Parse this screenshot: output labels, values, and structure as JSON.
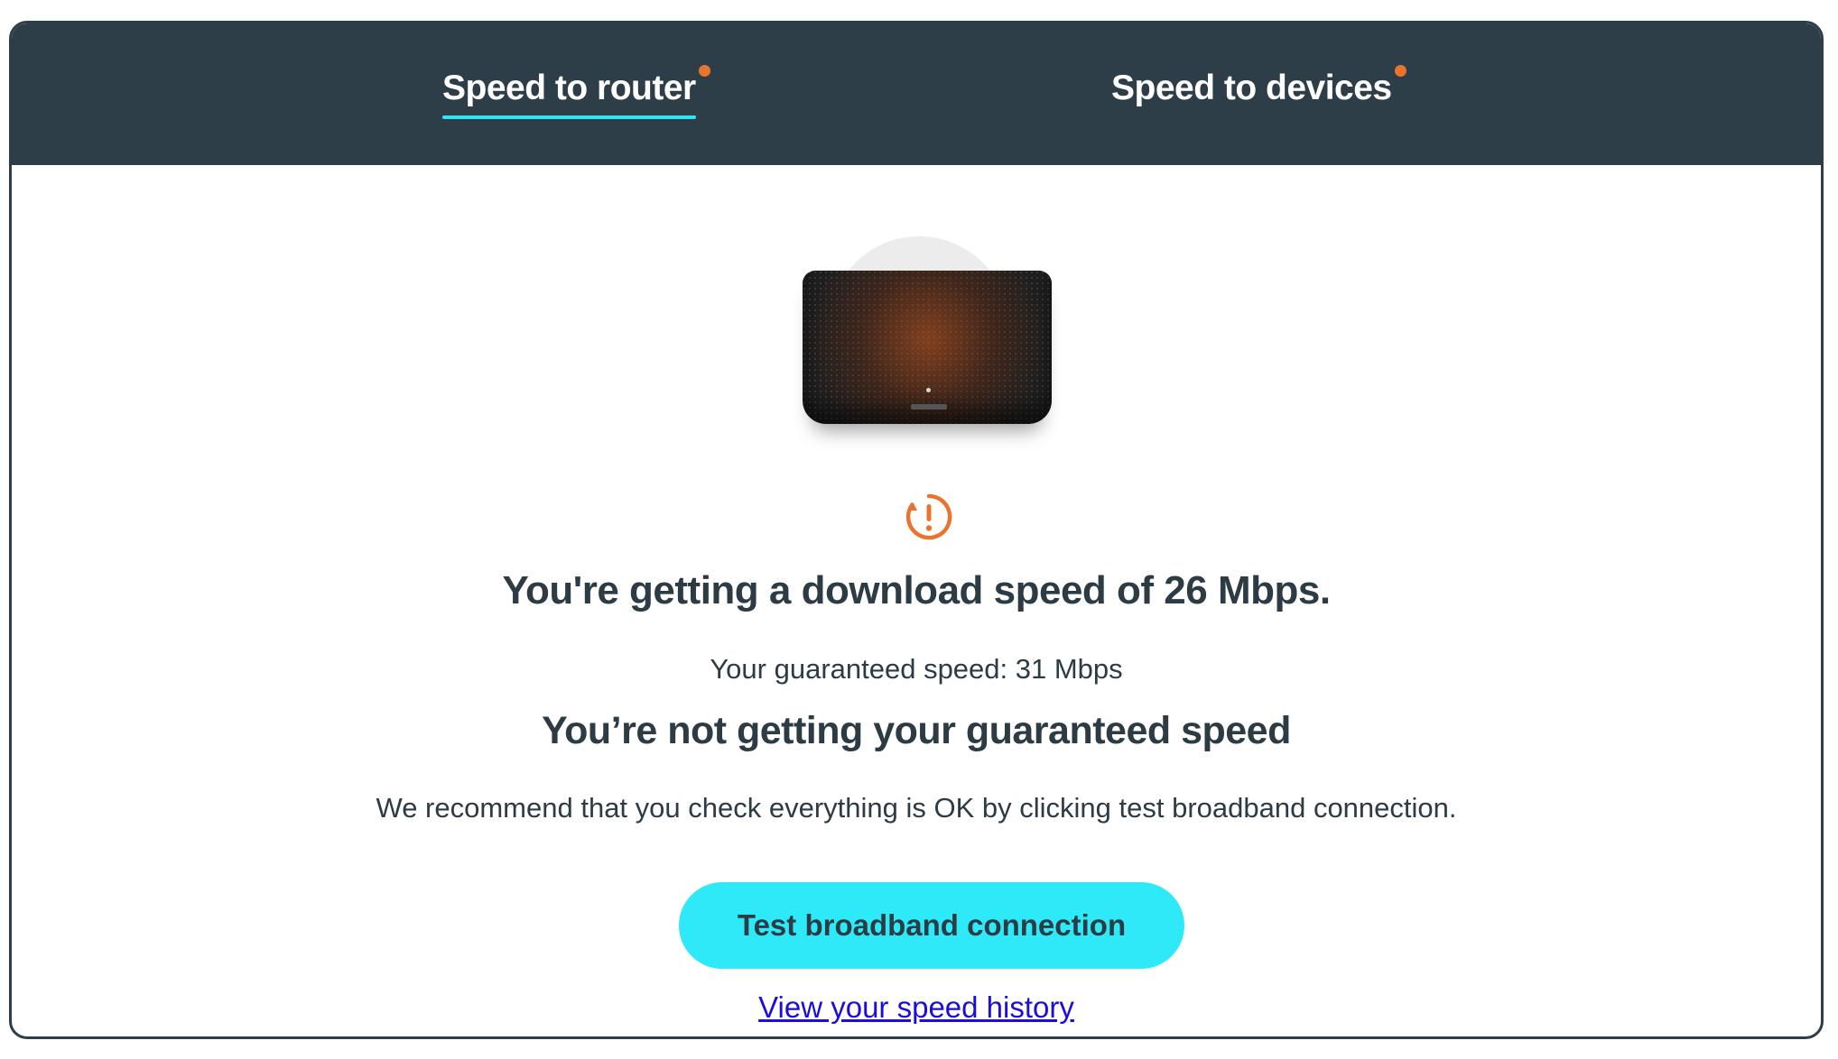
{
  "tabs": [
    {
      "label": "Speed to router",
      "active": true
    },
    {
      "label": "Speed to devices",
      "active": false
    }
  ],
  "icons": {
    "router": "router-image",
    "warning": "exclamation-circle-icon"
  },
  "result": {
    "headline": "You're getting a download speed of 26 Mbps.",
    "guaranteed": "Your guaranteed speed: 31 Mbps",
    "status": "You’re not getting your guaranteed speed",
    "recommendation": "We recommend that you check everything is OK by clicking test broadband connection."
  },
  "actions": {
    "test_button": "Test broadband connection",
    "history_link": "View your speed history"
  },
  "colors": {
    "header_bg": "#2e3e48",
    "tab_underline": "#2ee6f6",
    "notification_dot": "#e8742f",
    "warning": "#e8742f",
    "button_bg": "#2ee9f8",
    "link": "#1a0dde"
  }
}
